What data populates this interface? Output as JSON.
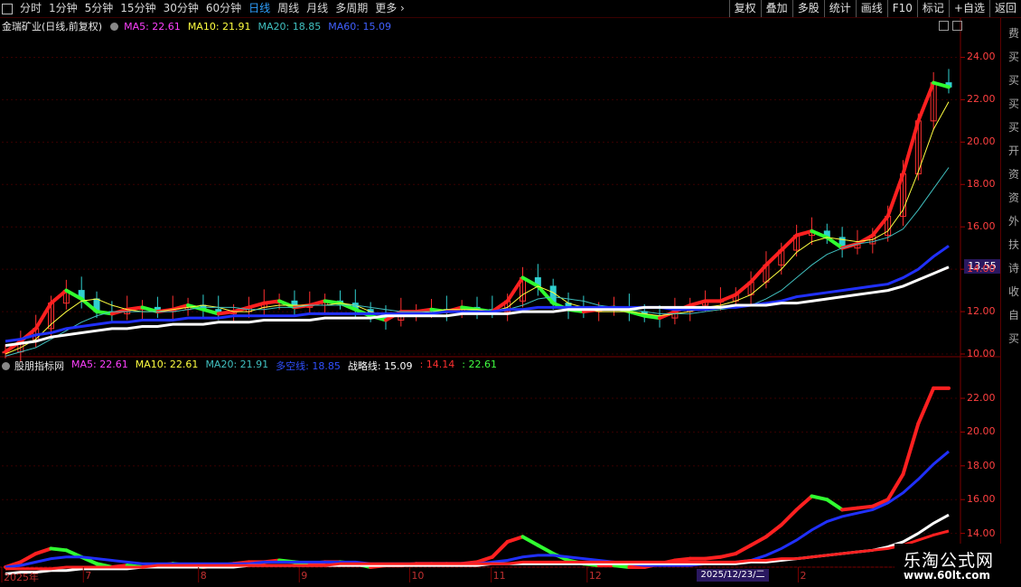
{
  "toolbar": {
    "periods": [
      "分时",
      "1分钟",
      "5分钟",
      "15分钟",
      "30分钟",
      "60分钟",
      "日线",
      "周线",
      "月线",
      "多周期",
      "更多"
    ],
    "active_period": "日线",
    "right_buttons": [
      "复权",
      "叠加",
      "多股",
      "统计",
      "画线",
      "F10",
      "标记",
      "+自选",
      "返回"
    ]
  },
  "main_panel": {
    "title": "金瑞矿业(日线,前复权)",
    "indicators": [
      {
        "label": "MA5: 22.61",
        "color": "#ff40ff"
      },
      {
        "label": "MA10: 21.91",
        "color": "#ffff40"
      },
      {
        "label": "MA20: 18.85",
        "color": "#40c0c0"
      },
      {
        "label": "MA60: 15.09",
        "color": "#4060ff"
      }
    ],
    "price_tag": "13.55"
  },
  "sub_panel": {
    "title": "股朋指标网",
    "indicators": [
      {
        "label": "MA5: 22.61",
        "color": "#ff40ff"
      },
      {
        "label": "MA10: 22.61",
        "color": "#ffff40"
      },
      {
        "label": "MA20: 21.91",
        "color": "#40c0c0"
      },
      {
        "label": "多空线: 18.85",
        "color": "#3050ff"
      },
      {
        "label": "战略线: 15.09",
        "color": "#ffffff"
      },
      {
        "label": ": 14.14",
        "color": "#ff3030"
      },
      {
        "label": ": 22.61",
        "color": "#40ff40"
      }
    ]
  },
  "x_axis": {
    "labels": [
      {
        "text": "2025年",
        "at": 0
      },
      {
        "text": "7",
        "at": 0.085
      },
      {
        "text": "8",
        "at": 0.205
      },
      {
        "text": "9",
        "at": 0.31
      },
      {
        "text": "10",
        "at": 0.425
      },
      {
        "text": "11",
        "at": 0.51
      },
      {
        "text": "12",
        "at": 0.61
      },
      {
        "text": "2",
        "at": 0.83
      }
    ],
    "cursor_date": "2025/12/23/二"
  },
  "side_text": [
    "费",
    "买",
    "买",
    "买",
    "买",
    "开",
    "资",
    "资",
    "外",
    "扶",
    "诗",
    "收",
    "自",
    "买"
  ],
  "watermark": {
    "title": "乐淘公式网",
    "url": "www.60lt.com"
  },
  "chart_data": [
    {
      "type": "line",
      "title": "金瑞矿业(日线,前复权)",
      "ylim": [
        10,
        25
      ],
      "yticks": [
        10,
        12,
        14,
        16,
        18,
        20,
        22,
        24
      ],
      "grid": true,
      "series": [
        {
          "name": "MA5",
          "values": [
            10.1,
            10.6,
            11.2,
            12.4,
            13.0,
            12.6,
            12.0,
            11.9,
            12.1,
            12.2,
            12.0,
            12.1,
            12.3,
            12.1,
            11.9,
            12.0,
            12.2,
            12.4,
            12.5,
            12.2,
            12.3,
            12.5,
            12.4,
            12.1,
            11.8,
            11.6,
            12.0,
            12.0,
            12.1,
            12.0,
            12.2,
            12.1,
            12.0,
            12.5,
            13.6,
            13.2,
            12.4,
            12.1,
            12.0,
            12.1,
            12.2,
            12.0,
            11.8,
            11.7,
            12.0,
            12.3,
            12.5,
            12.5,
            12.8,
            13.4,
            14.2,
            14.9,
            15.6,
            15.8,
            15.5,
            15.0,
            15.2,
            15.6,
            16.5,
            18.5,
            21.0,
            22.8,
            22.6
          ]
        },
        {
          "name": "MA10",
          "values": [
            10.0,
            10.3,
            10.7,
            11.4,
            12.0,
            12.5,
            12.6,
            12.3,
            12.1,
            12.0,
            12.0,
            12.1,
            12.2,
            12.3,
            12.2,
            12.0,
            12.0,
            12.2,
            12.3,
            12.3,
            12.3,
            12.3,
            12.4,
            12.3,
            12.0,
            11.8,
            11.9,
            11.9,
            12.0,
            12.1,
            12.1,
            12.1,
            12.0,
            12.2,
            12.8,
            13.2,
            12.9,
            12.4,
            12.2,
            12.0,
            12.0,
            12.0,
            11.9,
            11.8,
            11.9,
            12.0,
            12.2,
            12.3,
            12.5,
            12.8,
            13.4,
            14.0,
            14.8,
            15.3,
            15.5,
            15.4,
            15.3,
            15.4,
            15.8,
            16.8,
            18.6,
            20.6,
            21.9
          ]
        },
        {
          "name": "MA20",
          "values": [
            9.9,
            10.1,
            10.3,
            10.7,
            11.1,
            11.5,
            11.8,
            12.0,
            12.0,
            12.0,
            12.0,
            12.0,
            12.1,
            12.2,
            12.2,
            12.2,
            12.1,
            12.1,
            12.2,
            12.2,
            12.3,
            12.3,
            12.3,
            12.3,
            12.2,
            12.1,
            12.0,
            12.0,
            12.0,
            12.0,
            12.0,
            12.0,
            12.0,
            12.1,
            12.3,
            12.6,
            12.7,
            12.6,
            12.5,
            12.3,
            12.2,
            12.1,
            12.0,
            11.9,
            11.9,
            11.9,
            12.0,
            12.1,
            12.2,
            12.3,
            12.6,
            13.0,
            13.6,
            14.2,
            14.7,
            15.0,
            15.2,
            15.3,
            15.5,
            15.9,
            16.8,
            17.8,
            18.8
          ]
        },
        {
          "name": "MA60",
          "values": [
            10.6,
            10.7,
            10.9,
            11.0,
            11.2,
            11.3,
            11.4,
            11.5,
            11.5,
            11.6,
            11.6,
            11.6,
            11.7,
            11.7,
            11.7,
            11.8,
            11.8,
            11.8,
            11.8,
            11.8,
            11.9,
            11.9,
            11.9,
            11.9,
            11.9,
            11.9,
            11.9,
            11.9,
            11.9,
            12.0,
            12.0,
            12.0,
            12.0,
            12.1,
            12.1,
            12.2,
            12.2,
            12.2,
            12.2,
            12.2,
            12.2,
            12.2,
            12.2,
            12.2,
            12.1,
            12.1,
            12.1,
            12.2,
            12.2,
            12.3,
            12.4,
            12.5,
            12.7,
            12.8,
            12.9,
            13.0,
            13.1,
            13.2,
            13.3,
            13.6,
            14.0,
            14.6,
            15.1
          ]
        },
        {
          "name": "战略线",
          "values": [
            10.4,
            10.5,
            10.6,
            10.8,
            10.9,
            11.0,
            11.1,
            11.2,
            11.2,
            11.3,
            11.3,
            11.4,
            11.4,
            11.4,
            11.5,
            11.5,
            11.5,
            11.6,
            11.6,
            11.6,
            11.6,
            11.7,
            11.7,
            11.7,
            11.7,
            11.8,
            11.8,
            11.8,
            11.8,
            11.8,
            11.9,
            11.9,
            11.9,
            11.9,
            12.0,
            12.0,
            12.0,
            12.1,
            12.1,
            12.1,
            12.1,
            12.1,
            12.2,
            12.2,
            12.2,
            12.2,
            12.2,
            12.2,
            12.3,
            12.3,
            12.3,
            12.4,
            12.4,
            12.5,
            12.6,
            12.7,
            12.8,
            12.9,
            13.0,
            13.2,
            13.5,
            13.8,
            14.1
          ]
        }
      ]
    },
    {
      "type": "line",
      "title": "股朋指标网",
      "ylim": [
        12,
        23.5
      ],
      "yticks": [
        12,
        14,
        16,
        18,
        20,
        22
      ],
      "grid": true,
      "series": [
        {
          "name": "MA5",
          "values": [
            12.0,
            12.3,
            12.8,
            13.1,
            13.0,
            12.6,
            12.2,
            12.0,
            12.1,
            12.0,
            12.1,
            12.2,
            12.1,
            12.0,
            12.1,
            12.2,
            12.3,
            12.3,
            12.4,
            12.3,
            12.2,
            12.3,
            12.3,
            12.2,
            12.0,
            12.1,
            12.1,
            12.2,
            12.2,
            12.2,
            12.2,
            12.3,
            12.6,
            13.5,
            13.8,
            13.3,
            12.8,
            12.4,
            12.2,
            12.1,
            12.1,
            12.0,
            12.0,
            12.2,
            12.4,
            12.5,
            12.5,
            12.6,
            12.8,
            13.3,
            13.8,
            14.5,
            15.4,
            16.2,
            16.0,
            15.4,
            15.5,
            15.6,
            16.0,
            17.5,
            20.5,
            22.6,
            22.6
          ]
        },
        {
          "name": "多空线",
          "values": [
            12.0,
            12.1,
            12.3,
            12.5,
            12.6,
            12.6,
            12.5,
            12.4,
            12.3,
            12.2,
            12.2,
            12.2,
            12.2,
            12.2,
            12.2,
            12.2,
            12.2,
            12.3,
            12.3,
            12.3,
            12.3,
            12.3,
            12.3,
            12.3,
            12.2,
            12.2,
            12.2,
            12.2,
            12.2,
            12.2,
            12.2,
            12.2,
            12.3,
            12.4,
            12.6,
            12.7,
            12.7,
            12.6,
            12.5,
            12.4,
            12.3,
            12.2,
            12.1,
            12.1,
            12.1,
            12.1,
            12.2,
            12.2,
            12.3,
            12.4,
            12.7,
            13.1,
            13.6,
            14.2,
            14.7,
            15.0,
            15.2,
            15.4,
            15.8,
            16.4,
            17.2,
            18.1,
            18.85
          ]
        },
        {
          "name": "战略线",
          "values": [
            11.6,
            11.7,
            11.7,
            11.8,
            11.8,
            11.9,
            11.9,
            11.9,
            11.9,
            12.0,
            12.0,
            12.0,
            12.0,
            12.0,
            12.0,
            12.0,
            12.1,
            12.1,
            12.1,
            12.1,
            12.1,
            12.1,
            12.1,
            12.1,
            12.1,
            12.1,
            12.1,
            12.1,
            12.1,
            12.1,
            12.1,
            12.1,
            12.2,
            12.2,
            12.2,
            12.2,
            12.2,
            12.2,
            12.2,
            12.2,
            12.2,
            12.2,
            12.2,
            12.2,
            12.2,
            12.2,
            12.2,
            12.2,
            12.2,
            12.3,
            12.3,
            12.4,
            12.5,
            12.6,
            12.7,
            12.8,
            12.9,
            13.0,
            13.2,
            13.5,
            14.0,
            14.6,
            15.09
          ]
        },
        {
          "name": ": 14.14",
          "values": [
            11.9,
            11.9,
            11.9,
            11.9,
            12.0,
            12.0,
            12.0,
            12.0,
            12.0,
            12.0,
            12.1,
            12.1,
            12.1,
            12.1,
            12.1,
            12.1,
            12.1,
            12.1,
            12.1,
            12.1,
            12.1,
            12.1,
            12.2,
            12.2,
            12.2,
            12.2,
            12.2,
            12.2,
            12.2,
            12.2,
            12.2,
            12.2,
            12.2,
            12.2,
            12.3,
            12.3,
            12.3,
            12.3,
            12.3,
            12.3,
            12.3,
            12.3,
            12.3,
            12.3,
            12.3,
            12.3,
            12.3,
            12.3,
            12.3,
            12.4,
            12.4,
            12.5,
            12.5,
            12.6,
            12.7,
            12.8,
            12.9,
            13.0,
            13.1,
            13.3,
            13.6,
            13.9,
            14.14
          ]
        }
      ]
    }
  ]
}
